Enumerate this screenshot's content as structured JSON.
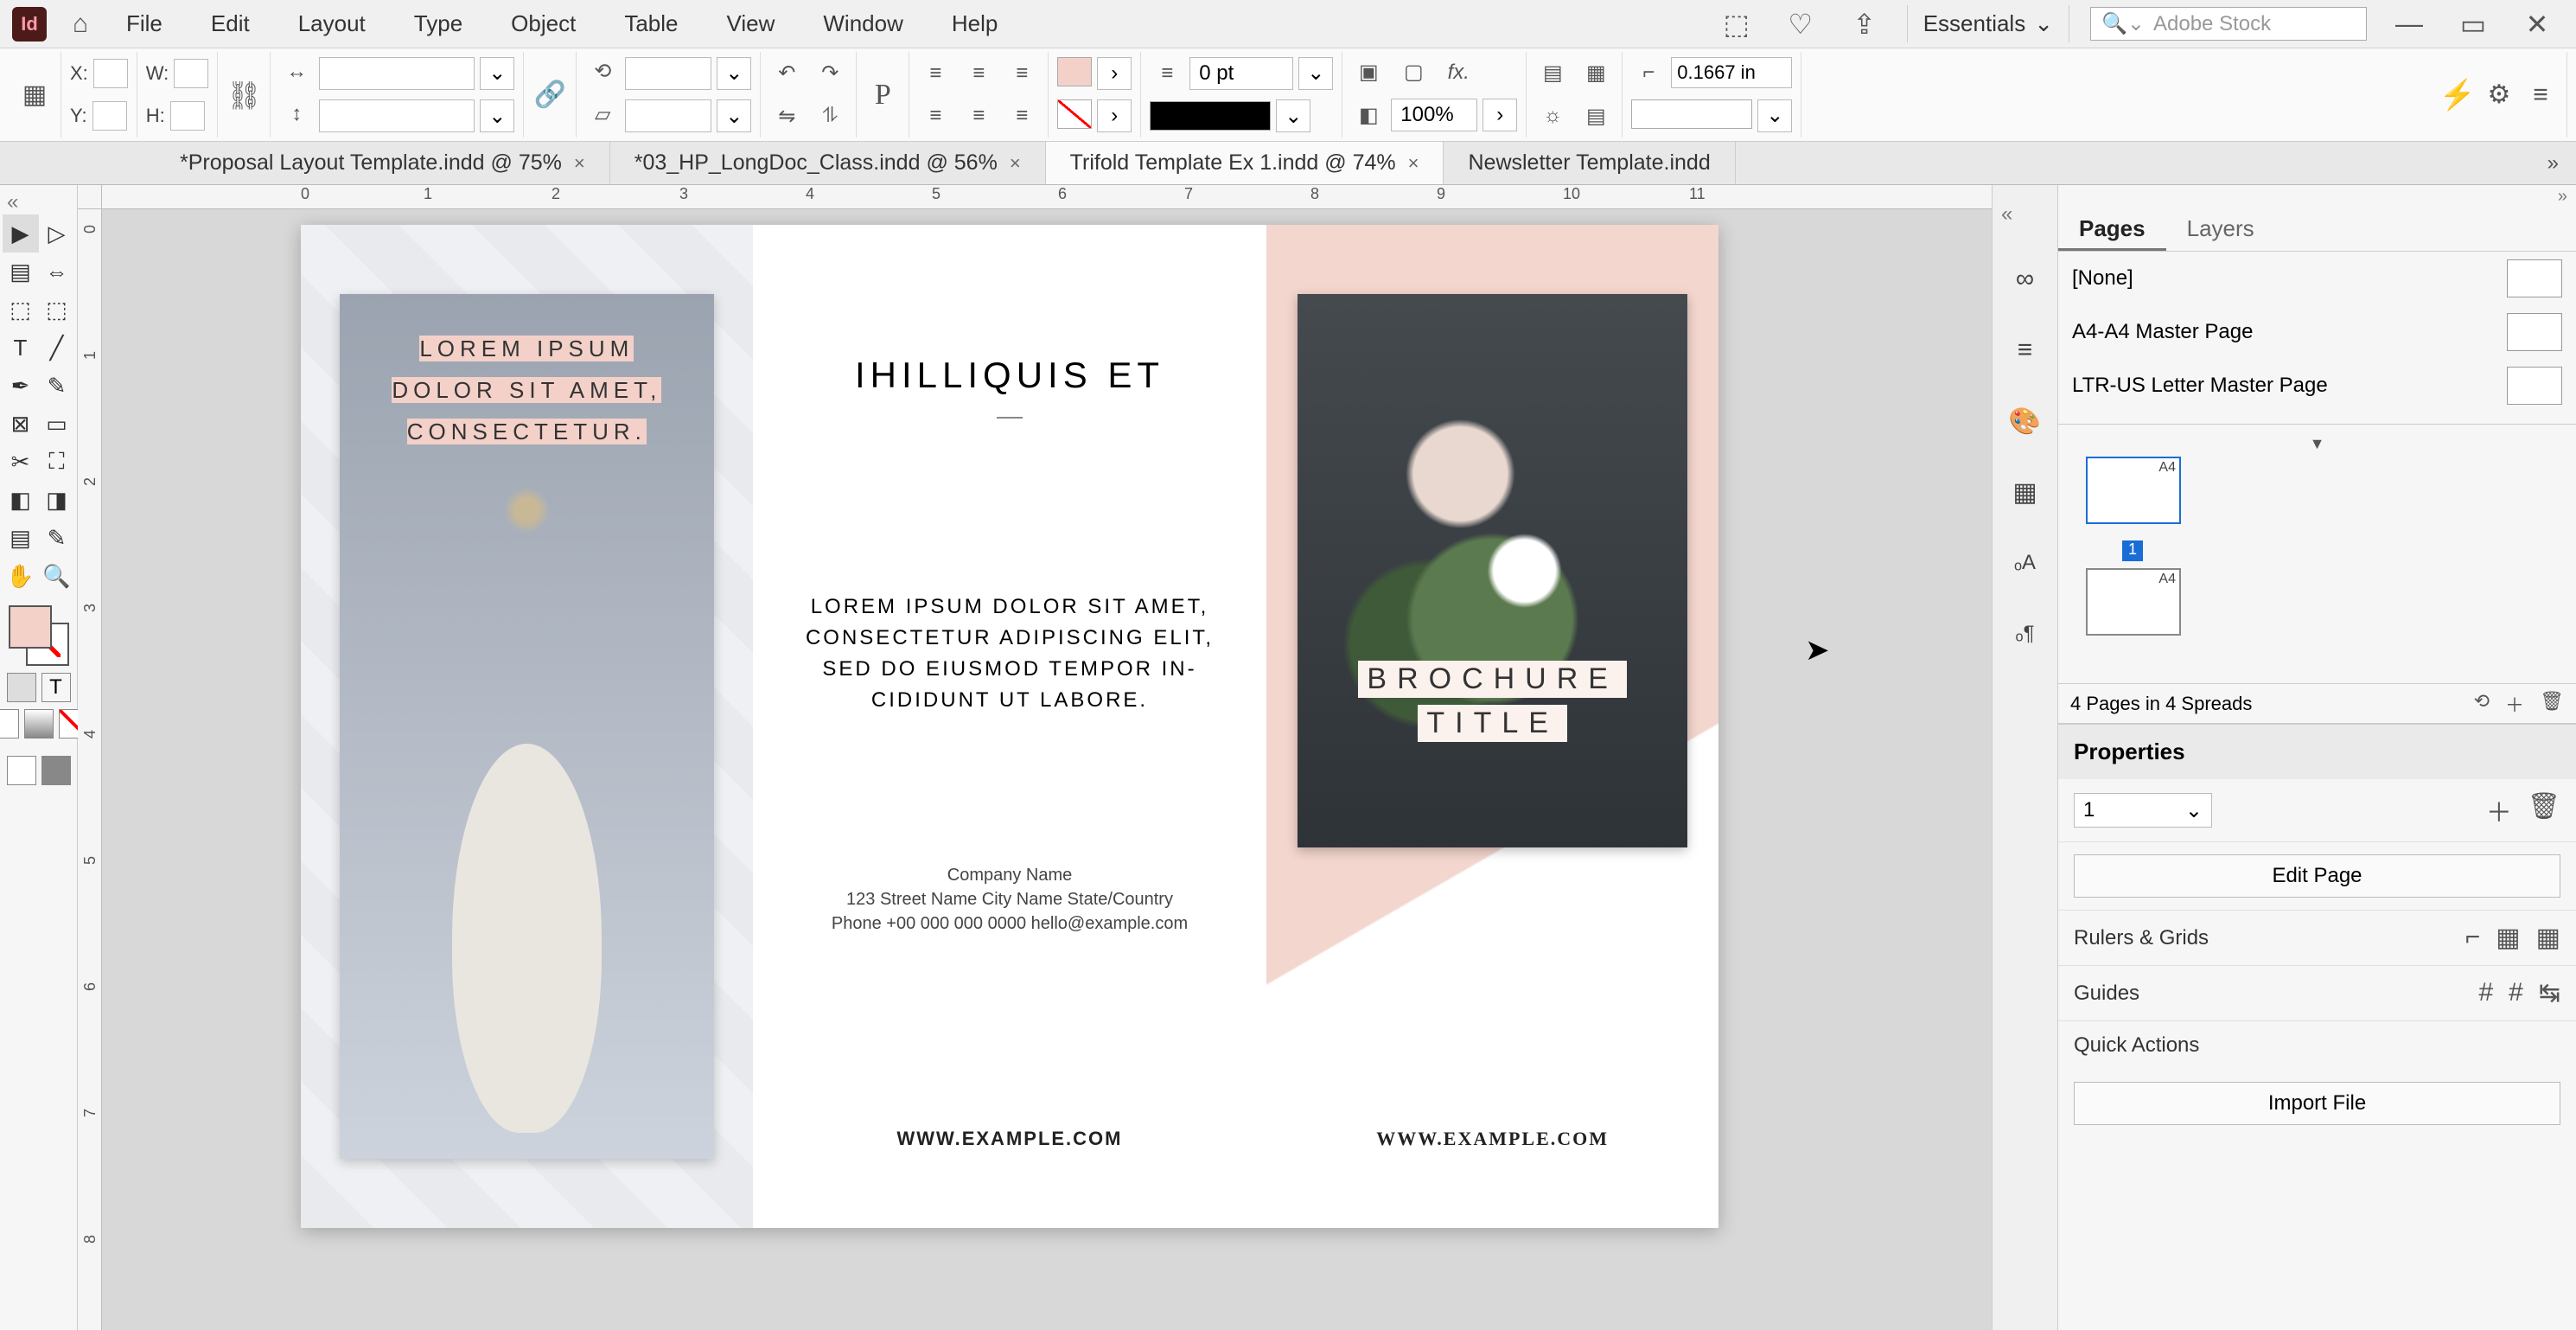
{
  "menu": {
    "items": [
      "File",
      "Edit",
      "Layout",
      "Type",
      "Object",
      "Table",
      "View",
      "Window",
      "Help"
    ]
  },
  "workspace": "Essentials",
  "stock_placeholder": "Adobe Stock",
  "control": {
    "x_label": "X:",
    "y_label": "Y:",
    "w_label": "W:",
    "h_label": "H:",
    "stroke_pt": "0 pt",
    "zoom": "100%",
    "units": "0.1667 in"
  },
  "tabs": [
    {
      "label": "*Proposal Layout Template.indd @ 75%",
      "active": false
    },
    {
      "label": "*03_HP_LongDoc_Class.indd @ 56%",
      "active": false
    },
    {
      "label": "Trifold Template Ex 1.indd @ 74%",
      "active": true
    },
    {
      "label": "Newsletter Template.indd",
      "active": false
    }
  ],
  "ruler_h": [
    "0",
    "1",
    "2",
    "3",
    "4",
    "5",
    "6",
    "7",
    "8",
    "9",
    "10",
    "11"
  ],
  "ruler_v": [
    "0",
    "1",
    "2",
    "3",
    "4",
    "5",
    "6",
    "7",
    "8"
  ],
  "doc": {
    "panel1_caption_l1": "LOREM IPSUM",
    "panel1_caption_l2": "DOLOR SIT AMET,",
    "panel1_caption_l3": "CONSECTETUR.",
    "panel2_heading": "IHILLIQUIS ET",
    "panel2_body": "LOREM IPSUM DOLOR SIT AMET, CONSECTETUR ADIPISCING ELIT, SED DO EIUSMOD TEMPOR IN-CIDIDUNT UT LABORE.",
    "company_name": "Company Name",
    "address": "123 Street Name City Name State/Country",
    "phone_email": "Phone +00 000 000 0000 hello@example.com",
    "url": "WWW.EXAMPLE.COM",
    "panel3_title_l1": "BROCHURE",
    "panel3_title_l2": "TITLE"
  },
  "panels": {
    "pages_tab": "Pages",
    "layers_tab": "Layers",
    "master_none": "[None]",
    "master_a4": "A4-A4 Master Page",
    "master_ltr": "LTR-US Letter Master Page",
    "thumb_label": "A4",
    "page_badge": "1",
    "pages_footer": "4 Pages in 4 Spreads",
    "properties": "Properties",
    "page_selector": "1",
    "edit_page": "Edit Page",
    "rulers_grids": "Rulers & Grids",
    "guides": "Guides",
    "quick_actions": "Quick Actions",
    "import_file": "Import File"
  }
}
